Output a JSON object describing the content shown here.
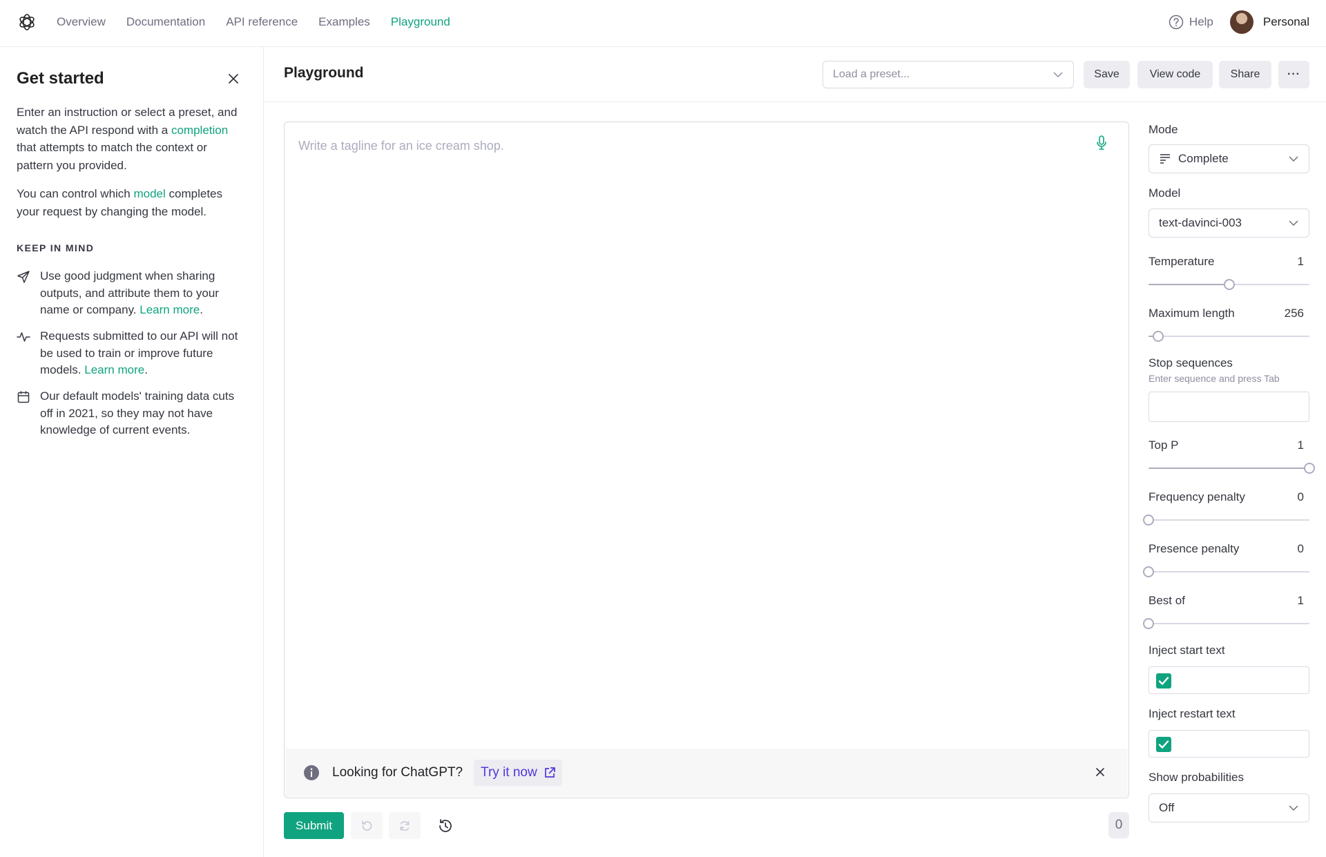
{
  "nav": {
    "links": [
      "Overview",
      "Documentation",
      "API reference",
      "Examples",
      "Playground"
    ],
    "active": "Playground",
    "help": "Help",
    "account": "Personal"
  },
  "sidebar": {
    "title": "Get started",
    "intro_1_a": "Enter an instruction or select a preset, and watch the API respond with a ",
    "intro_1_link": "completion",
    "intro_1_b": " that attempts to match the context or pattern you provided.",
    "intro_2_a": "You can control which ",
    "intro_2_link": "model",
    "intro_2_b": " completes your request by changing the model.",
    "keep_in_mind": "KEEP IN MIND",
    "tips": [
      {
        "text": "Use good judgment when sharing outputs, and attribute them to your name or company. ",
        "link": "Learn more",
        "after": "."
      },
      {
        "text": "Requests submitted to our API will not be used to train or improve future models. ",
        "link": "Learn more",
        "after": "."
      },
      {
        "text": "Our default models' training data cuts off in 2021, so they may not have knowledge of current events.",
        "link": "",
        "after": ""
      }
    ]
  },
  "header": {
    "title": "Playground",
    "preset_placeholder": "Load a preset...",
    "save": "Save",
    "view_code": "View code",
    "share": "Share",
    "more": "···"
  },
  "editor": {
    "placeholder": "Write a tagline for an ice cream shop.",
    "banner_text": "Looking for ChatGPT?",
    "banner_link": "Try it now"
  },
  "footer": {
    "submit": "Submit",
    "token_count": "0"
  },
  "settings": {
    "mode_label": "Mode",
    "mode_value": "Complete",
    "model_label": "Model",
    "model_value": "text-davinci-003",
    "temperature": {
      "label": "Temperature",
      "value": "1",
      "fraction": 0.5
    },
    "max_length": {
      "label": "Maximum length",
      "value": "256",
      "fraction": 0.06
    },
    "stop_label": "Stop sequences",
    "stop_hint": "Enter sequence and press Tab",
    "top_p": {
      "label": "Top P",
      "value": "1",
      "fraction": 1.0
    },
    "frequency_penalty": {
      "label": "Frequency penalty",
      "value": "0",
      "fraction": 0.0
    },
    "presence_penalty": {
      "label": "Presence penalty",
      "value": "0",
      "fraction": 0.0
    },
    "best_of": {
      "label": "Best of",
      "value": "1",
      "fraction": 0.0
    },
    "inject_start_label": "Inject start text",
    "inject_start_checked": true,
    "inject_restart_label": "Inject restart text",
    "inject_restart_checked": true,
    "show_prob_label": "Show probabilities",
    "show_prob_value": "Off"
  },
  "colors": {
    "accent": "#10a37f",
    "link_purple": "#5436da"
  }
}
